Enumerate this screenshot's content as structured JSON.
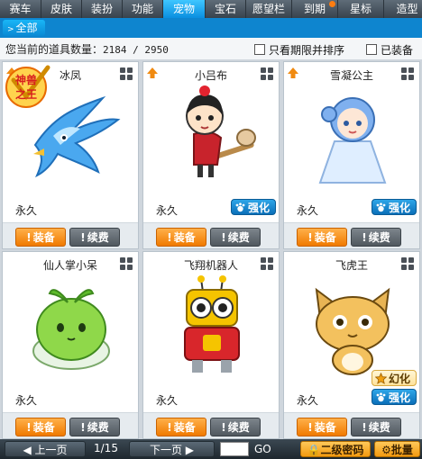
{
  "tabs": [
    "赛车",
    "皮肤",
    "装扮",
    "功能",
    "宠物",
    "宝石",
    "愿望栏",
    "到期",
    "星标",
    "造型"
  ],
  "active_tab": "宠物",
  "subtab": {
    "label": "全部",
    "arrow": ">"
  },
  "count": {
    "label": "您当前的道具数量：",
    "value": "2184 / 2950"
  },
  "filters": {
    "expiry_sort": "只看期限并排序",
    "equipped": "已装备"
  },
  "cards": [
    {
      "name": "冰凤",
      "duration": "永久",
      "equip": "装备",
      "renew": "续费",
      "tag": "神兽之王",
      "badges": []
    },
    {
      "name": "小吕布",
      "duration": "永久",
      "equip": "装备",
      "renew": "续费",
      "badges": [
        "强化"
      ]
    },
    {
      "name": "雪凝公主",
      "duration": "永久",
      "equip": "装备",
      "renew": "续费",
      "badges": [
        "强化"
      ]
    },
    {
      "name": "仙人掌小呆",
      "duration": "永久",
      "equip": "装备",
      "renew": "续费",
      "badges": []
    },
    {
      "name": "飞翔机器人",
      "duration": "永久",
      "equip": "装备",
      "renew": "续费",
      "badges": []
    },
    {
      "name": "飞虎王",
      "duration": "永久",
      "equip": "装备",
      "renew": "续费",
      "badges": [
        "幻化",
        "强化"
      ]
    }
  ],
  "footer": {
    "prev": "上一页",
    "page": "1/15",
    "next": "下一页",
    "go": "GO",
    "password": "二级密码",
    "batch": "批量"
  },
  "colors": {
    "active_tab": "#0a8fe0",
    "equip_button": "#f07a00",
    "enhance_badge": "#0b6fb8"
  }
}
